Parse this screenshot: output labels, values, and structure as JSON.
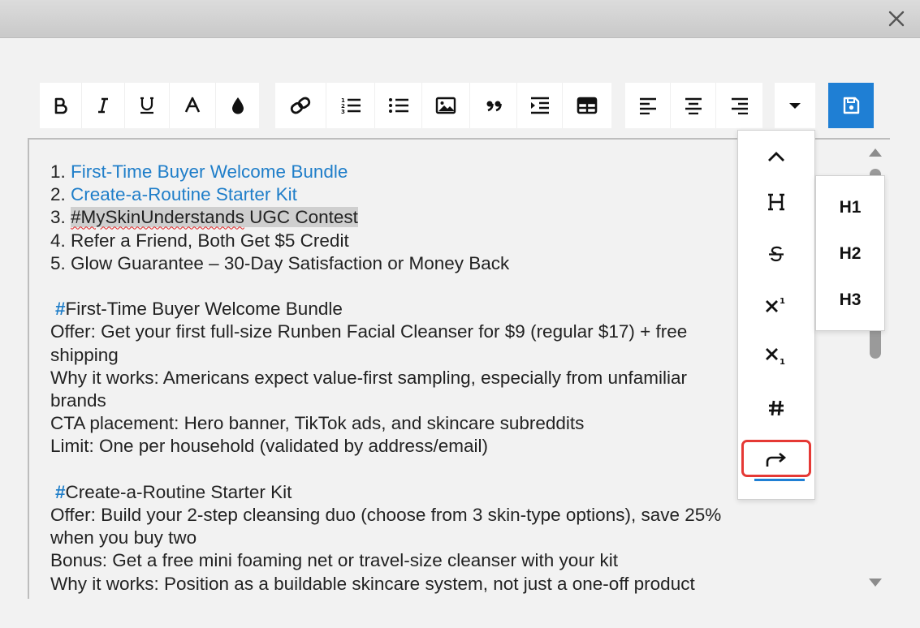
{
  "editor": {
    "lines": [
      {
        "type": "list",
        "num": "1. ",
        "text": "First-Time Buyer Welcome Bundle",
        "style": "link"
      },
      {
        "type": "list",
        "num": "2. ",
        "text": "Create-a-Routine Starter Kit",
        "style": "link"
      },
      {
        "type": "list-hl",
        "num": "3. ",
        "tag": "#MySkinUnderstands",
        "rest": " UGC Contest"
      },
      {
        "type": "list",
        "num": "4. ",
        "text": "Refer a Friend, Both Get $5 Credit",
        "style": "plain"
      },
      {
        "type": "list",
        "num": "5. ",
        "text": "Glow Guarantee – 30-Day Satisfaction or Money Back",
        "style": "plain"
      },
      {
        "type": "gap"
      },
      {
        "type": "heading",
        "hash": "#",
        "text": "First-Time Buyer Welcome Bundle"
      },
      {
        "type": "text",
        "text": "Offer: Get your first full-size Runben Facial Cleanser for $9 (regular $17) + free"
      },
      {
        "type": "text",
        "text": "shipping"
      },
      {
        "type": "text",
        "text": "Why it works: Americans expect value-first sampling, especially from unfamiliar"
      },
      {
        "type": "text",
        "text": "brands"
      },
      {
        "type": "text",
        "text": "CTA placement: Hero banner, TikTok ads, and skincare subreddits"
      },
      {
        "type": "text",
        "text": "Limit: One per household (validated by address/email)"
      },
      {
        "type": "gap"
      },
      {
        "type": "heading",
        "hash": "#",
        "text": "Create-a-Routine Starter Kit"
      },
      {
        "type": "text",
        "text": "Offer: Build your 2-step cleansing duo (choose from 3 skin-type options), save 25%"
      },
      {
        "type": "text",
        "text": "when you buy two"
      },
      {
        "type": "text",
        "text": "Bonus: Get a free mini foaming net or travel-size cleanser with your kit"
      },
      {
        "type": "text",
        "text": "Why it works: Position as a buildable skincare system, not just a one-off product"
      }
    ]
  },
  "toolbar": {
    "group1": [
      "bold-icon",
      "italic-icon",
      "underline-icon",
      "font-size-icon",
      "color-drop-icon"
    ],
    "group2": [
      "link-icon",
      "ordered-list-icon",
      "unordered-list-icon",
      "image-icon",
      "blockquote-icon",
      "indent-icon",
      "table-icon"
    ],
    "group3": [
      "align-left-icon",
      "align-center-icon",
      "align-right-icon"
    ],
    "more": "caret-down-icon",
    "save": "save-icon"
  },
  "dropdown": {
    "items": [
      "chevron-up-icon",
      "heading-icon",
      "strikethrough-icon",
      "superscript-icon",
      "subscript-icon",
      "hash-icon",
      "redo-icon"
    ],
    "submenu": [
      "H1",
      "H2",
      "H3"
    ]
  },
  "colors": {
    "accent": "#1f7fd4",
    "link": "#1f7ec9",
    "highlight_outline": "#e53935",
    "background": "#f2f2f2"
  }
}
